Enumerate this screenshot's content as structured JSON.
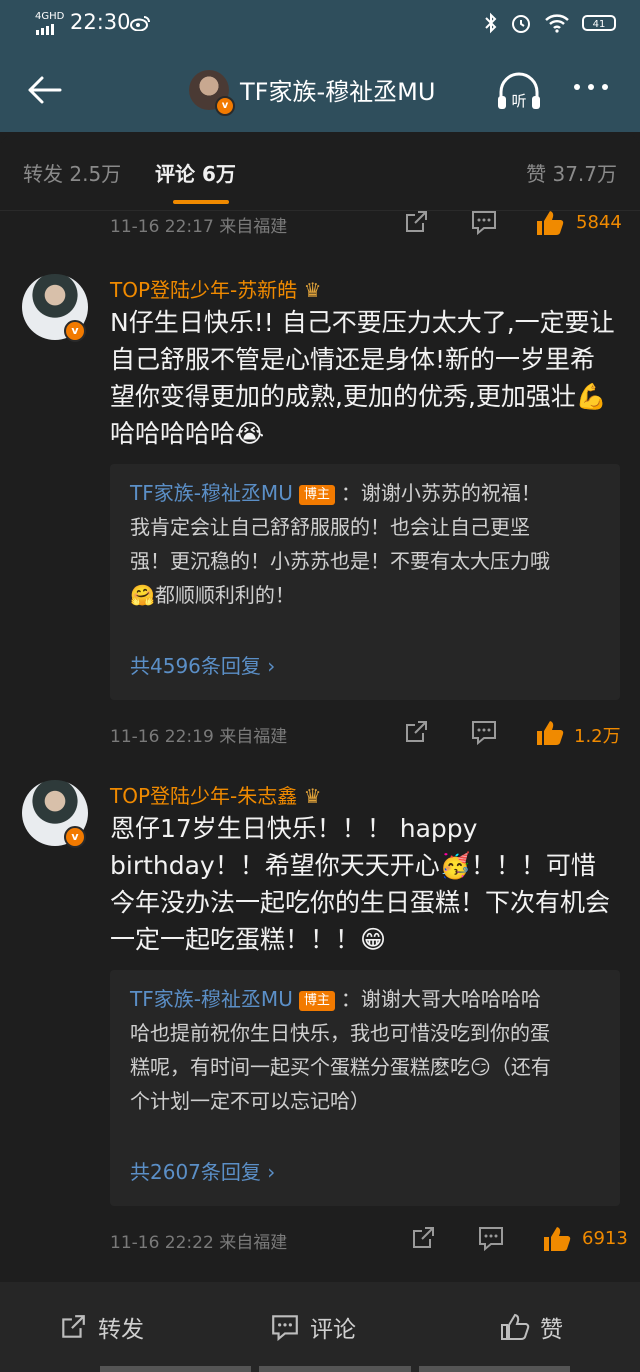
{
  "status": {
    "network": "4GHD",
    "time": "22:30",
    "battery": "41"
  },
  "header": {
    "title": "TF家族-穆祉丞MU",
    "listen_label": "听"
  },
  "tabs": [
    {
      "label": "转发 2.5万"
    },
    {
      "label": "评论 6万",
      "active": true
    },
    {
      "label": "赞 37.7万"
    }
  ],
  "top_meta": {
    "time": "11-16 22:17  来自福建",
    "likes": "5844"
  },
  "comments": [
    {
      "author": "TOP登陆少年-苏新皓",
      "text": "N仔生日快乐!! 自己不要压力太大了,一定要让自己舒服不管是心情还是身体!新的一岁里希望你变得更加的成熟,更加的优秀,更加强壮💪哈哈哈哈哈😭",
      "reply": {
        "author": "TF家族-穆祉丞MU",
        "badge": "博主",
        "text": "：谢谢小苏苏的祝福！我肯定会让自己舒舒服服的！也会让自己更坚强！更沉稳的！小苏苏也是！不要有太大压力哦🤗都顺顺利利的！",
        "more": "共4596条回复  ›"
      },
      "time": "11-16 22:19  来自福建",
      "likes": "1.2万"
    },
    {
      "author": "TOP登陆少年-朱志鑫",
      "text": "恩仔17岁生日快乐！！！ happy birthday！！希望你天天开心🥳！！！可惜今年没办法一起吃你的生日蛋糕！下次有机会一定一起吃蛋糕！！！😁",
      "reply": {
        "author": "TF家族-穆祉丞MU",
        "badge": "博主",
        "text": "：谢谢大哥大哈哈哈哈哈也提前祝你生日快乐，我也可惜没吃到你的蛋糕呢，有时间一起买个蛋糕分蛋糕麽吃😏（还有个计划一定不可以忘记哈）",
        "more": "共2607条回复  ›"
      },
      "time": "11-16 22:22  来自福建",
      "likes": "6913"
    }
  ],
  "bottom": {
    "repost": "转发",
    "comment": "评论",
    "like": "赞"
  },
  "colors": {
    "accent": "#f08a00",
    "link": "#5b8fc7",
    "header_bg": "#2f4e5c"
  }
}
